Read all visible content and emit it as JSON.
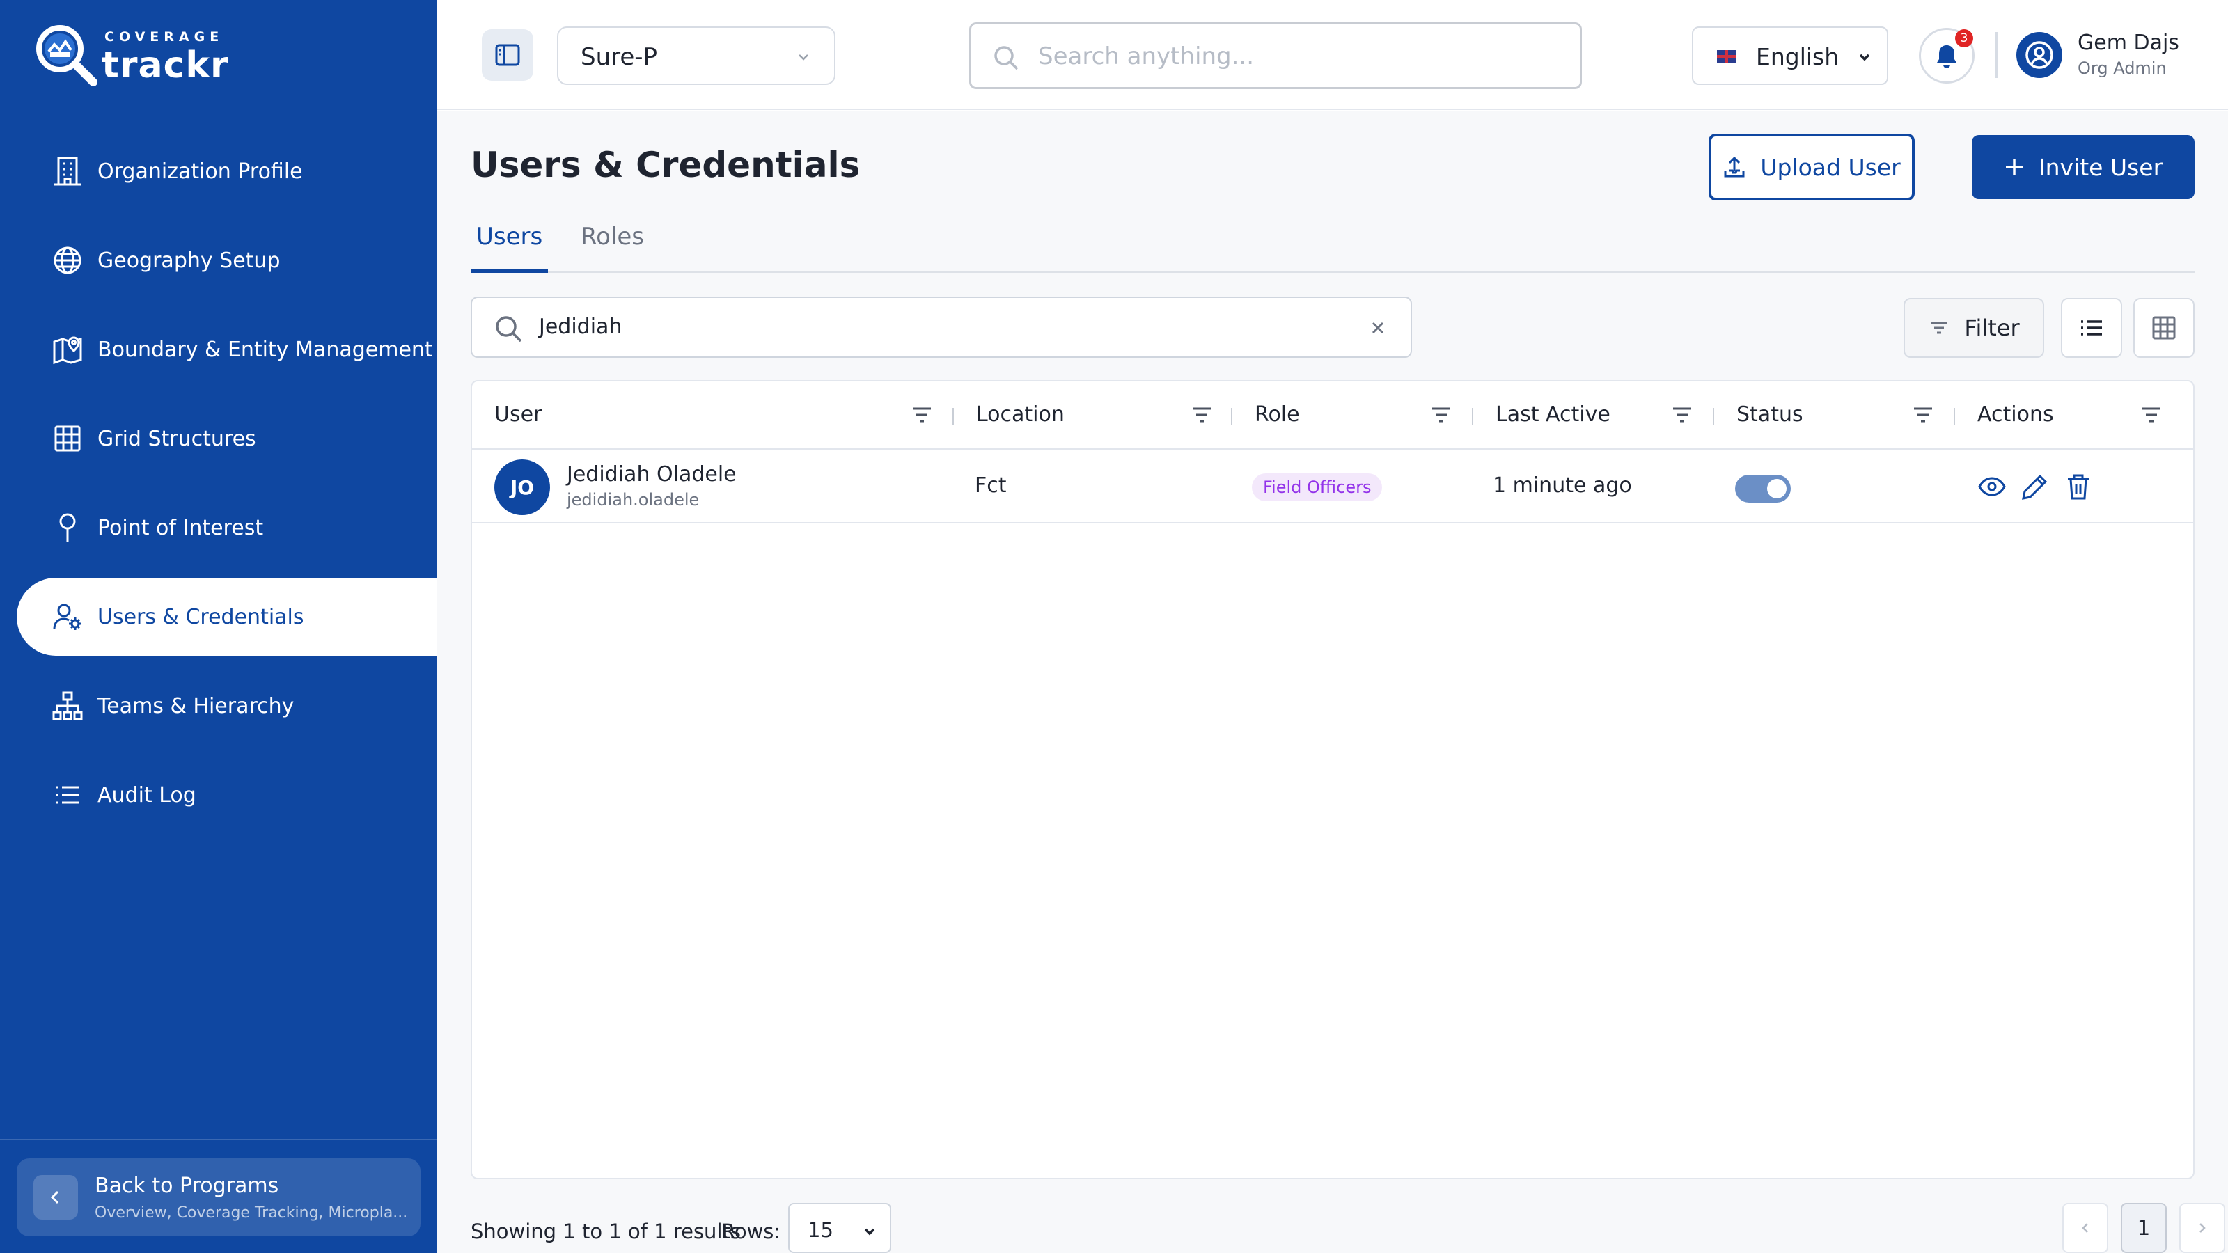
{
  "brand": {
    "small": "COVERAGE",
    "name": "trackr"
  },
  "sidebar": {
    "items": [
      {
        "label": "Organization Profile",
        "icon": "building-icon"
      },
      {
        "label": "Geography Setup",
        "icon": "globe-icon"
      },
      {
        "label": "Boundary & Entity Management",
        "icon": "map-pin-icon"
      },
      {
        "label": "Grid Structures",
        "icon": "grid-icon"
      },
      {
        "label": "Point of Interest",
        "icon": "pin-icon"
      },
      {
        "label": "Users & Credentials",
        "icon": "user-cog-icon",
        "active": true
      },
      {
        "label": "Teams & Hierarchy",
        "icon": "hierarchy-icon"
      },
      {
        "label": "Audit Log",
        "icon": "list-icon"
      }
    ],
    "back": {
      "title": "Back to Programs",
      "subtitle": "Overview, Coverage Tracking, Micropla..."
    }
  },
  "topbar": {
    "program": "Sure-P",
    "search_placeholder": "Search anything...",
    "language": "English",
    "notification_count": "3",
    "user_name": "Gem Dajs",
    "user_role": "Org Admin"
  },
  "page": {
    "title": "Users & Credentials",
    "upload_label": "Upload User",
    "invite_label": "Invite User",
    "tabs": [
      {
        "label": "Users",
        "active": true
      },
      {
        "label": "Roles"
      }
    ],
    "search_value": "Jedidiah",
    "filter_label": "Filter"
  },
  "table": {
    "columns": [
      "User",
      "Location",
      "Role",
      "Last Active",
      "Status",
      "Actions"
    ],
    "rows": [
      {
        "initials": "JO",
        "name": "Jedidiah Oladele",
        "username": "jedidiah.oladele",
        "location": "Fct",
        "role": "Field Officers",
        "last_active": "1 minute ago",
        "status_enabled": true
      }
    ]
  },
  "footer": {
    "showing": "Showing 1 to 1 of 1 results",
    "rows_label": "Rows:",
    "rows_value": "15",
    "page": "1"
  },
  "colors": {
    "primary": "#0f47a1",
    "role_pill_bg": "#f3e8fb",
    "role_pill_text": "#9333ea",
    "badge": "#e02424"
  }
}
